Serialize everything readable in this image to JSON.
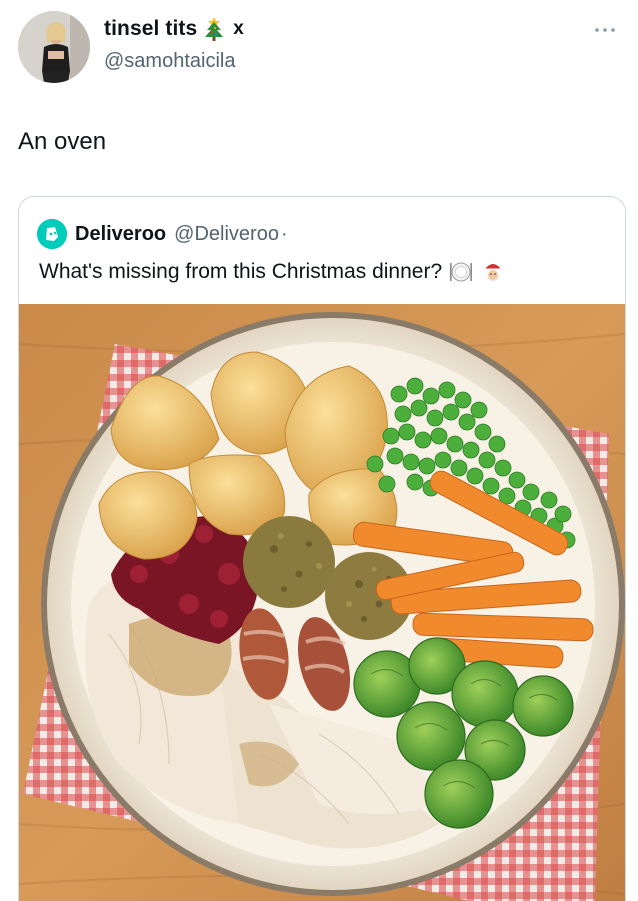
{
  "author": {
    "display_name": "tinsel tits",
    "handle": "@samohtaicila",
    "name_suffix": "x",
    "name_emoji_icon": "christmas-tree-icon"
  },
  "tweet": {
    "text": "An oven"
  },
  "quoted": {
    "display_name": "Deliveroo",
    "handle": "@Deliveroo",
    "separator": "·",
    "text": "What's missing from this Christmas dinner?",
    "emoji_icons": [
      "plate-cutlery-icon",
      "santa-icon"
    ],
    "brand_color": "#00ccbc"
  },
  "colors": {
    "text_primary": "#0f1419",
    "text_secondary": "#536471",
    "border": "#cfd9de"
  }
}
